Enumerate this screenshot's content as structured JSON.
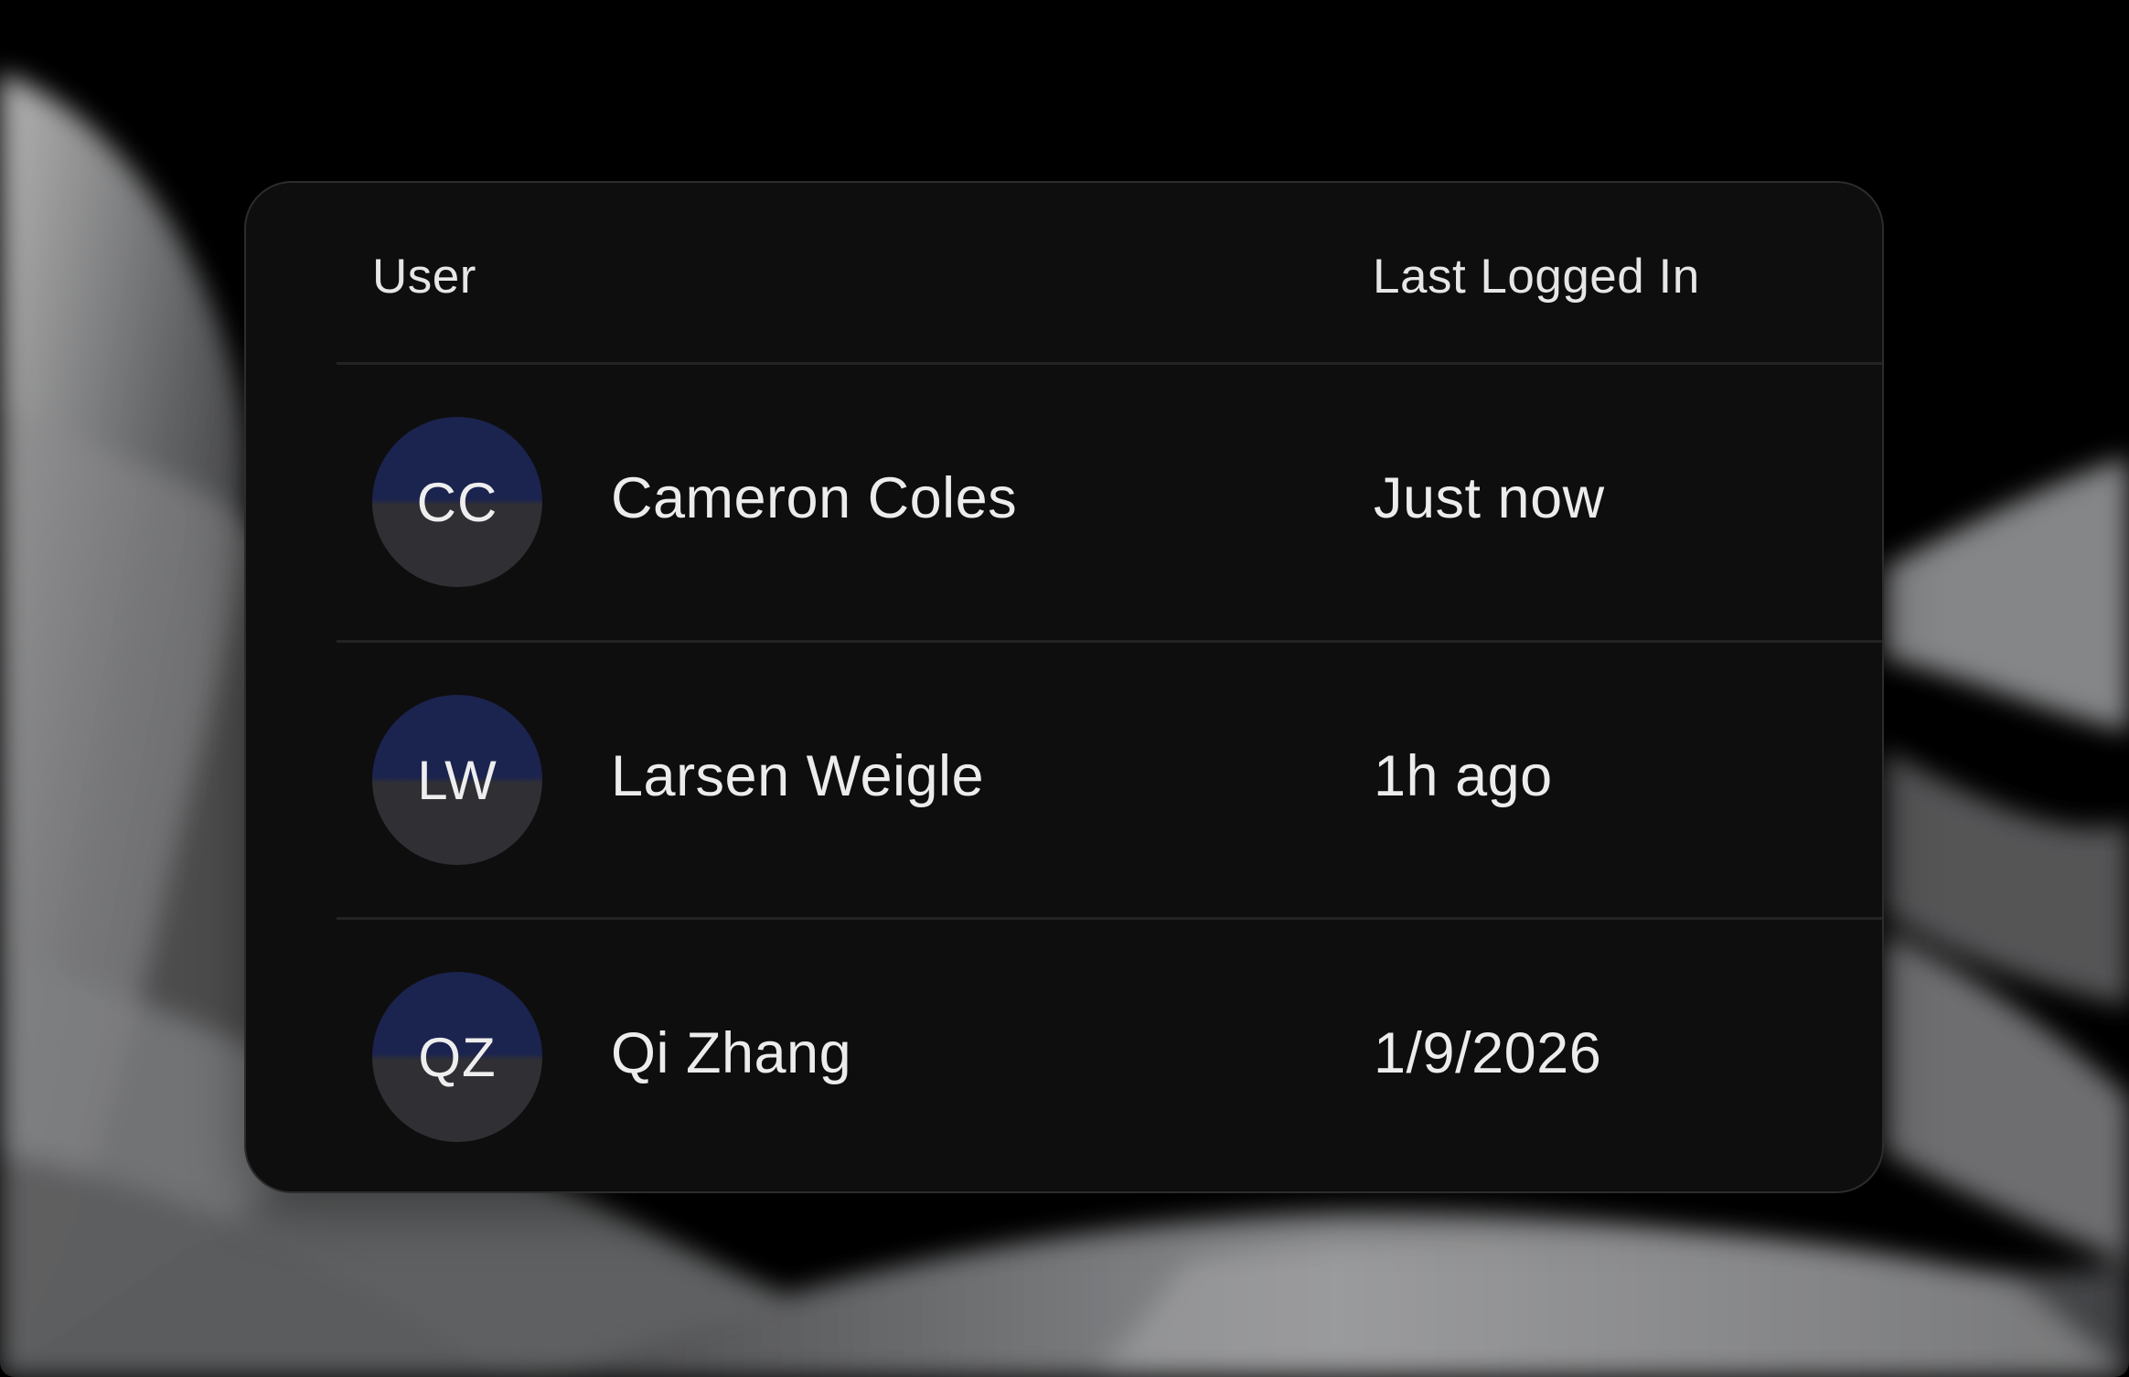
{
  "table": {
    "columns": {
      "user": "User",
      "last_logged_in": "Last Logged In"
    },
    "rows": [
      {
        "initials": "CC",
        "name": "Cameron Coles",
        "last_logged_in": "Just now"
      },
      {
        "initials": "LW",
        "name": "Larsen Weigle",
        "last_logged_in": "1h ago"
      },
      {
        "initials": "QZ",
        "name": "Qi Zhang",
        "last_logged_in": "1/9/2026"
      }
    ]
  },
  "colors": {
    "background": "#000000",
    "card": "#0e0e0f",
    "avatar_top": "#1b234f",
    "avatar_bottom": "#303034",
    "text": "#ececec"
  }
}
